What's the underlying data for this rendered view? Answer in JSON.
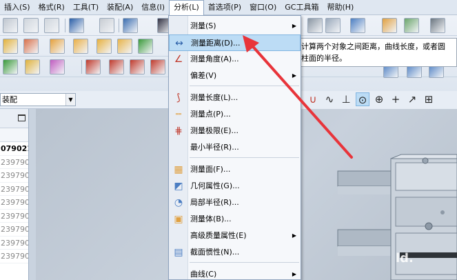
{
  "menubar": {
    "items": [
      "插入(S)",
      "格式(R)",
      "工具(T)",
      "装配(A)",
      "信息(I)",
      "分析(L)",
      "首选项(P)",
      "窗口(O)",
      "GC工具箱",
      "帮助(H)"
    ],
    "active_index": 5
  },
  "assembly_combo": {
    "value": "装配"
  },
  "navigator": {
    "rows": [
      "079021-",
      "239790",
      "239790",
      "239790",
      "239790",
      "239790",
      "239790",
      "239790",
      "239790"
    ]
  },
  "analysis_menu": {
    "items": [
      {
        "label": "测量(S)",
        "icon": "none",
        "submenu": true
      },
      {
        "label": "测量距离(D)...",
        "icon": "measure-distance-icon",
        "highlighted": true
      },
      {
        "label": "测量角度(A)...",
        "icon": "measure-angle-icon"
      },
      {
        "label": "偏差(V)",
        "icon": "none",
        "submenu": true
      },
      {
        "label": "测量长度(L)...",
        "icon": "measure-length-icon"
      },
      {
        "label": "测量点(P)...",
        "icon": "measure-point-icon"
      },
      {
        "label": "测量极限(E)...",
        "icon": "measure-limit-icon"
      },
      {
        "label": "最小半径(R)...",
        "icon": "none"
      },
      {
        "label": "测量面(F)...",
        "icon": "measure-face-icon"
      },
      {
        "label": "几何属性(G)...",
        "icon": "geometry-props-icon"
      },
      {
        "label": "局部半径(R)...",
        "icon": "local-radius-icon"
      },
      {
        "label": "测量体(B)...",
        "icon": "measure-body-icon"
      },
      {
        "label": "高级质量属性(E)",
        "icon": "none",
        "submenu": true
      },
      {
        "label": "截面惯性(N)...",
        "icon": "section-inertia-icon"
      },
      {
        "label": "曲线(C)",
        "icon": "none",
        "submenu": true
      }
    ]
  },
  "tooltip": {
    "line1": "计算两个对象之间距离，曲线长度，或者圆",
    "line2": "柱面的半径。"
  },
  "watermark": "ld.",
  "colors": {
    "highlight": "#bcdcf5",
    "arrow": "#e8343a",
    "menubar": "#dfe7f1"
  }
}
